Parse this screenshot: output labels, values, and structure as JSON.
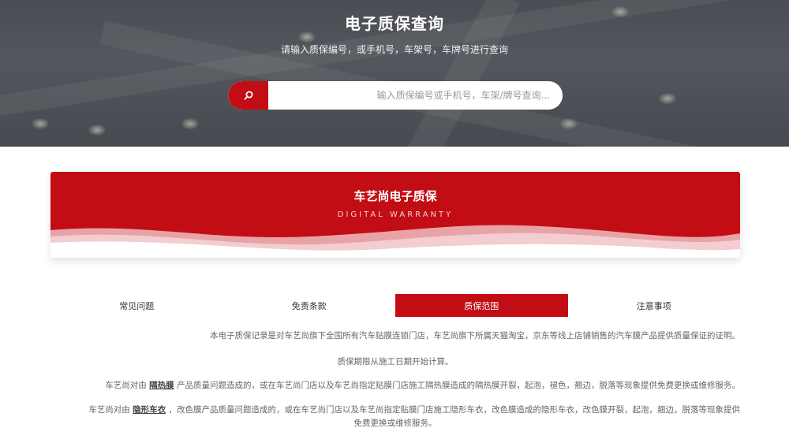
{
  "hero": {
    "title": "电子质保查询",
    "subtitle": "请输入质保编号，或手机号，车架号，车牌号进行查询",
    "search": {
      "placeholder": "输入质保编号或手机号，车架/牌号查询...",
      "button_icon": "search-icon"
    }
  },
  "banner": {
    "title": "车艺尚电子质保",
    "subtitle": "DIGITAL WARRANTY"
  },
  "tabs": [
    {
      "label": "注意事项"
    },
    {
      "label": "质保范围"
    },
    {
      "label": "免责条款"
    },
    {
      "label": "常见问题"
    }
  ],
  "active_tab": "质保范围",
  "content": {
    "p1": "本电子质保记录是对车艺尚旗下全国所有汽车贴膜连锁门店，车艺尚旗下所属天猫淘宝，京东等线上店铺销售的汽车膜产品提供质量保证的证明。",
    "p2": "质保期限从施工日期开始计算。",
    "p3_pre": "车艺尚对由",
    "p3_link": "隔热膜",
    "p3_post": "产品质量问题造成的，或在车艺尚门店以及车艺尚指定贴膜门店施工隔热膜造成的隔热膜开裂，起泡，褪色，翘边，脱落等现象提供免费更换或维修服务。",
    "p4_pre": "车艺尚对由",
    "p4_link": "隐形车衣",
    "p4_post": "，改色膜产品质量问题造成的，或在车艺尚门店以及车艺尚指定贴膜门店施工隐形车衣，改色膜造成的隐形车衣，改色膜开裂，起泡，翘边，脱落等现象提供",
    "p5": "免费更换或维修服务。"
  },
  "colors": {
    "brand_red": "#c20d15",
    "hero_bg": "#62656b",
    "text_gray": "#666666"
  }
}
